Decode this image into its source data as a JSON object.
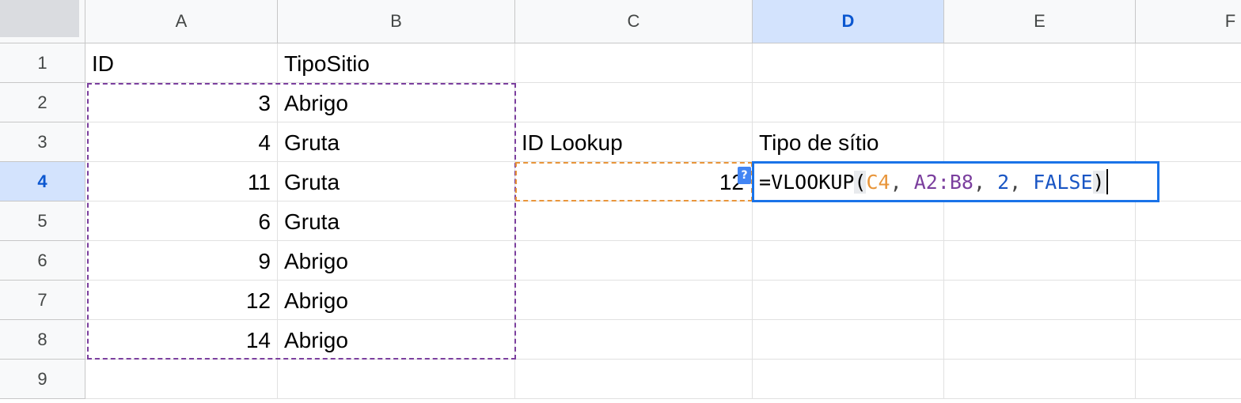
{
  "columns": [
    "A",
    "B",
    "C",
    "D",
    "E",
    "F"
  ],
  "rows": [
    "1",
    "2",
    "3",
    "4",
    "5",
    "6",
    "7",
    "8",
    "9"
  ],
  "active_column": "D",
  "active_row": "4",
  "cells": {
    "A1": "ID",
    "B1": "TipoSitio",
    "A2": "3",
    "B2": "Abrigo",
    "A3": "4",
    "B3": "Gruta",
    "C3": "ID Lookup",
    "D3": "Tipo de sítio",
    "A4": "11",
    "B4": "Gruta",
    "C4": "12",
    "A5": "6",
    "B5": "Gruta",
    "A6": "9",
    "B6": "Abrigo",
    "A7": "12",
    "B7": "Abrigo",
    "A8": "14",
    "B8": "Abrigo"
  },
  "formula": {
    "eq": "=",
    "fn": "VLOOKUP",
    "open": "(",
    "ref1": "C4",
    "sep1": ", ",
    "ref2": "A2:B8",
    "sep2": ", ",
    "num": "2",
    "sep3": ", ",
    "bool": "FALSE",
    "close": ")"
  },
  "help_badge": "?",
  "colors": {
    "active_header_bg": "#d3e3fd",
    "active_header_text": "#0b57d0",
    "selection_border": "#1a73e8",
    "range_purple": "#7b3f9e",
    "range_orange": "#e8953a"
  }
}
